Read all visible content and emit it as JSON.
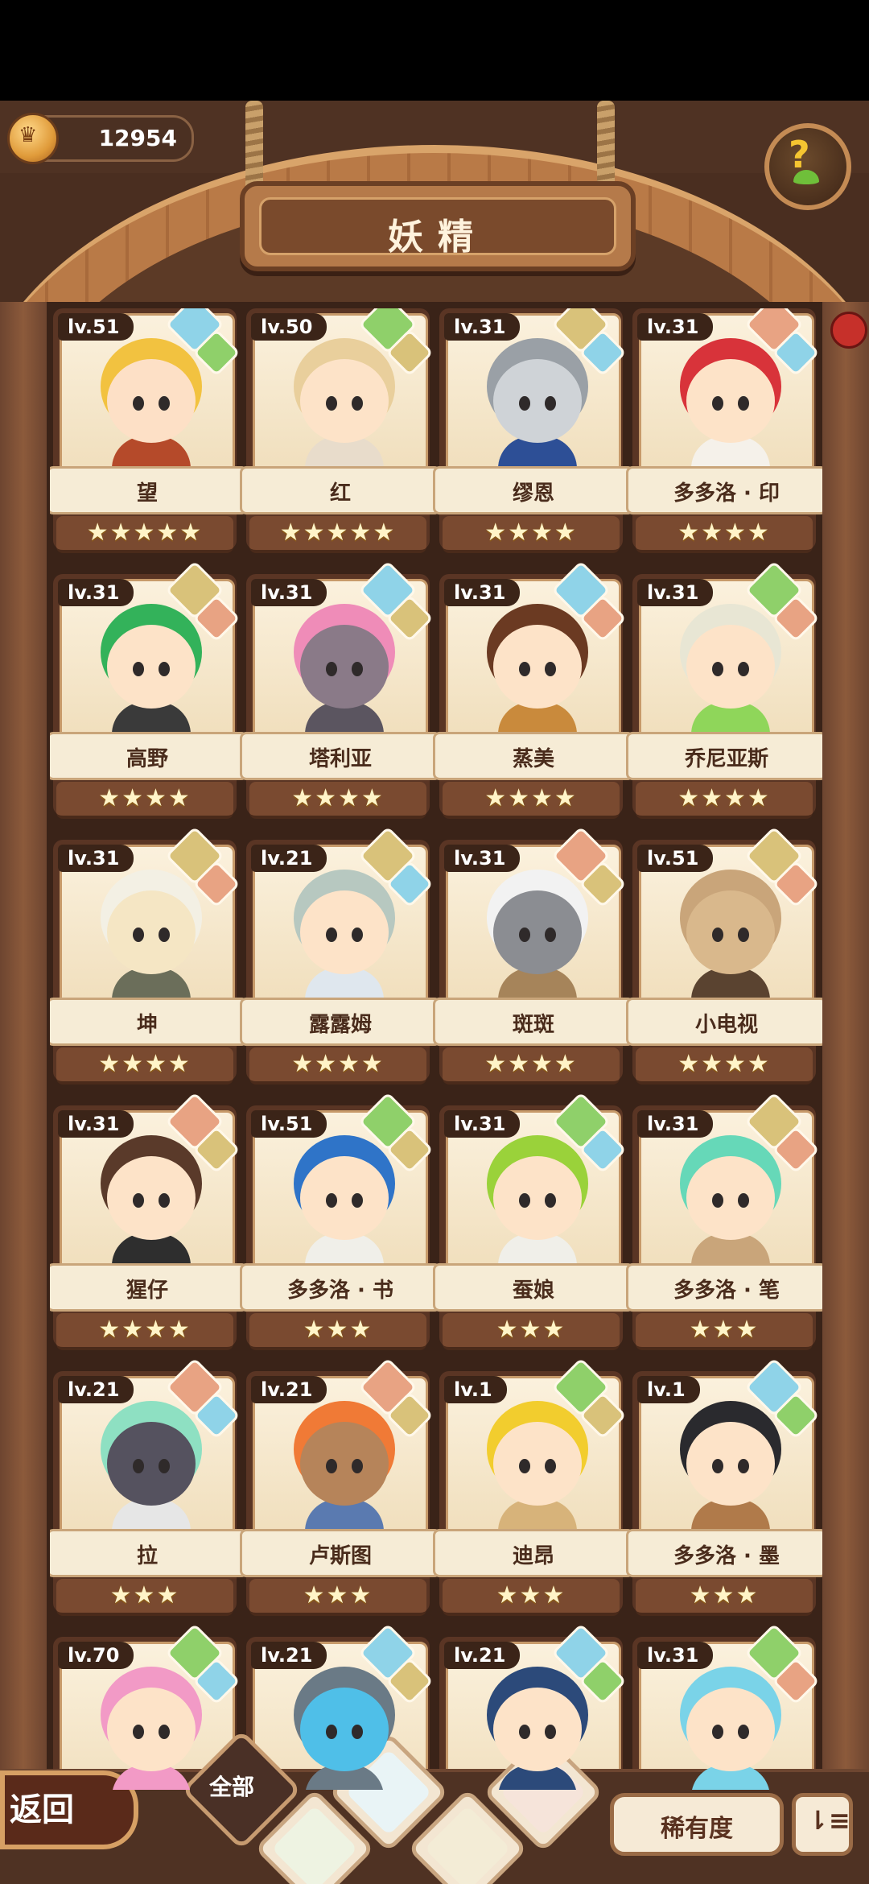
{
  "header": {
    "currency": "12954",
    "title": "妖精",
    "help": "?"
  },
  "cards": [
    {
      "lv": "lv.51",
      "name": "望",
      "stars": "★★★★★",
      "attrs": [
        "wind",
        "grass"
      ],
      "hair": "#f2c240",
      "skin": "#fde0c6",
      "cloth": "#b54a2a"
    },
    {
      "lv": "lv.50",
      "name": "红",
      "stars": "★★★★★",
      "attrs": [
        "grass",
        "rock"
      ],
      "hair": "#e9cf9c",
      "skin": "#fde3c8",
      "cloth": "#e8dccb"
    },
    {
      "lv": "lv.31",
      "name": "缪恩",
      "stars": "★★★★",
      "attrs": [
        "rock",
        "wind"
      ],
      "hair": "#9aa0a6",
      "skin": "#cfd3d7",
      "cloth": "#2d4f96"
    },
    {
      "lv": "lv.31",
      "name": "多多洛 · 印",
      "stars": "★★★★",
      "attrs": [
        "fire",
        "wind"
      ],
      "hair": "#d8333a",
      "skin": "#fde3c8",
      "cloth": "#f5f1ea"
    },
    {
      "lv": "lv.31",
      "name": "高野",
      "stars": "★★★★",
      "attrs": [
        "rock",
        "fire"
      ],
      "hair": "#33b25a",
      "skin": "#fde3c8",
      "cloth": "#3a3a3a"
    },
    {
      "lv": "lv.31",
      "name": "塔利亚",
      "stars": "★★★★",
      "attrs": [
        "wind",
        "rock"
      ],
      "hair": "#ef8cb8",
      "skin": "#8a7a88",
      "cloth": "#5b5560"
    },
    {
      "lv": "lv.31",
      "name": "蒸美",
      "stars": "★★★★",
      "attrs": [
        "wind",
        "fire"
      ],
      "hair": "#6b3a22",
      "skin": "#fde3c8",
      "cloth": "#c98a3c"
    },
    {
      "lv": "lv.31",
      "name": "乔尼亚斯",
      "stars": "★★★★",
      "attrs": [
        "grass",
        "fire"
      ],
      "hair": "#e8e6d4",
      "skin": "#fde3c8",
      "cloth": "#8fd65a"
    },
    {
      "lv": "lv.31",
      "name": "坤",
      "stars": "★★★★",
      "attrs": [
        "rock",
        "fire"
      ],
      "hair": "#f3f0e4",
      "skin": "#f5e6c4",
      "cloth": "#6b6e5a"
    },
    {
      "lv": "lv.21",
      "name": "露露姆",
      "stars": "★★★★",
      "attrs": [
        "rock",
        "wind"
      ],
      "hair": "#b7c8c0",
      "skin": "#fde3c8",
      "cloth": "#dfe7ee"
    },
    {
      "lv": "lv.31",
      "name": "斑斑",
      "stars": "★★★★",
      "attrs": [
        "fire",
        "rock"
      ],
      "hair": "#f2f2f2",
      "skin": "#8b8d92",
      "cloth": "#a6845a"
    },
    {
      "lv": "lv.51",
      "name": "小电视",
      "stars": "★★★★",
      "attrs": [
        "rock",
        "fire"
      ],
      "hair": "#c9a57a",
      "skin": "#d9b88c",
      "cloth": "#5a4330"
    },
    {
      "lv": "lv.31",
      "name": "猩仔",
      "stars": "★★★★",
      "attrs": [
        "fire",
        "rock"
      ],
      "hair": "#5a3a2a",
      "skin": "#fde3c8",
      "cloth": "#2e2e2e"
    },
    {
      "lv": "lv.51",
      "name": "多多洛 · 书",
      "stars": "★★★",
      "attrs": [
        "grass",
        "rock"
      ],
      "hair": "#2f74c8",
      "skin": "#fde3c8",
      "cloth": "#f0efe9"
    },
    {
      "lv": "lv.31",
      "name": "蚕娘",
      "stars": "★★★",
      "attrs": [
        "grass",
        "wind"
      ],
      "hair": "#9ad23a",
      "skin": "#fde3c8",
      "cloth": "#f0efe9"
    },
    {
      "lv": "lv.31",
      "name": "多多洛 · 笔",
      "stars": "★★★",
      "attrs": [
        "rock",
        "fire"
      ],
      "hair": "#66d8b8",
      "skin": "#fde3c8",
      "cloth": "#c9a57a"
    },
    {
      "lv": "lv.21",
      "name": "拉",
      "stars": "★★★",
      "attrs": [
        "fire",
        "wind"
      ],
      "hair": "#8ee0c2",
      "skin": "#55525f",
      "cloth": "#e6e6e6"
    },
    {
      "lv": "lv.21",
      "name": "卢斯图",
      "stars": "★★★",
      "attrs": [
        "fire",
        "rock"
      ],
      "hair": "#f07a36",
      "skin": "#b6845a",
      "cloth": "#5a7ab0"
    },
    {
      "lv": "lv.1",
      "name": "迪昂",
      "stars": "★★★",
      "attrs": [
        "grass",
        "rock"
      ],
      "hair": "#f2cd2e",
      "skin": "#fde3c8",
      "cloth": "#d7b37a"
    },
    {
      "lv": "lv.1",
      "name": "多多洛 · 墨",
      "stars": "★★★",
      "attrs": [
        "wind",
        "grass"
      ],
      "hair": "#2a2a2e",
      "skin": "#fde3c8",
      "cloth": "#b07a4a"
    },
    {
      "lv": "lv.70",
      "name": "",
      "stars": "",
      "attrs": [
        "grass",
        "wind"
      ],
      "hair": "#f29ac6",
      "skin": "#fde3c8",
      "cloth": "#f29ac6"
    },
    {
      "lv": "lv.21",
      "name": "",
      "stars": "",
      "attrs": [
        "wind",
        "rock"
      ],
      "hair": "#6a7a86",
      "skin": "#4fbfe8",
      "cloth": "#6a7a86"
    },
    {
      "lv": "lv.21",
      "name": "",
      "stars": "",
      "attrs": [
        "wind",
        "grass"
      ],
      "hair": "#2c4a7a",
      "skin": "#fde3c8",
      "cloth": "#2c4a7a"
    },
    {
      "lv": "lv.31",
      "name": "",
      "stars": "",
      "attrs": [
        "grass",
        "fire"
      ],
      "hair": "#7ad3e8",
      "skin": "#fde3c8",
      "cloth": "#7ad3e8"
    }
  ],
  "bottom": {
    "back": "返回",
    "filter_all": "全部",
    "filters": [
      "wind",
      "grass",
      "rock",
      "fire"
    ],
    "rarity": "稀有度",
    "sort": "⇂≡"
  },
  "colors": {
    "wind": "#8fd3e8",
    "grass": "#8fd06a",
    "rock": "#d9c27a",
    "fire": "#e8a383"
  }
}
